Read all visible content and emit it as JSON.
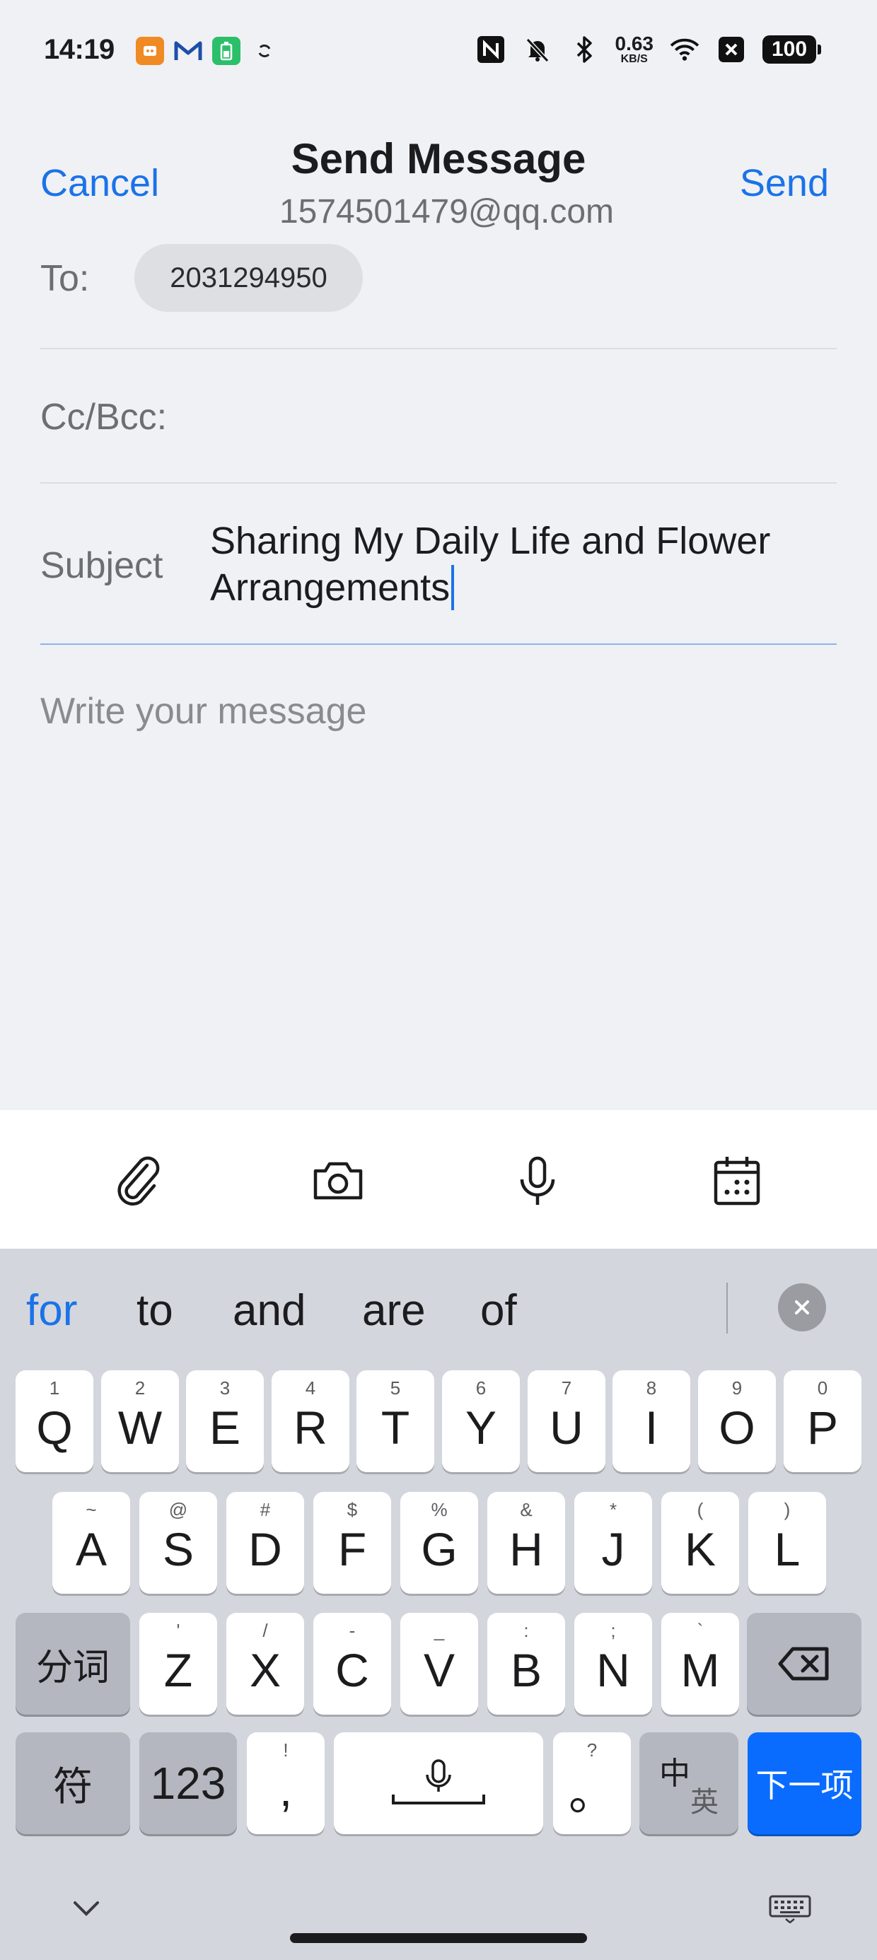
{
  "status_bar": {
    "time": "14:19",
    "net_speed_value": "0.63",
    "net_speed_unit": "KB/S",
    "battery": "100",
    "icons": [
      "app-icon",
      "mail-icon",
      "battery-app-icon",
      "sync-icon",
      "nfc-icon",
      "mute-icon",
      "bluetooth-icon",
      "wifi-icon",
      "x-app-icon"
    ]
  },
  "header": {
    "cancel_label": "Cancel",
    "title": "Send Message",
    "subtitle": "1574501479@qq.com",
    "send_label": "Send"
  },
  "form": {
    "to_label": "To:",
    "to_recipient": "2031294950",
    "cc_label": "Cc/Bcc:",
    "subject_label": "Subject",
    "subject_value": "Sharing My Daily Life and Flower Arrangements",
    "body_placeholder": "Write your message"
  },
  "toolbar": {
    "icons": [
      "paperclip-icon",
      "camera-icon",
      "microphone-icon",
      "calendar-icon"
    ]
  },
  "keyboard": {
    "suggestions": [
      "for",
      "to",
      "and",
      "are",
      "of"
    ],
    "row1": [
      {
        "main": "Q",
        "hint": "1"
      },
      {
        "main": "W",
        "hint": "2"
      },
      {
        "main": "E",
        "hint": "3"
      },
      {
        "main": "R",
        "hint": "4"
      },
      {
        "main": "T",
        "hint": "5"
      },
      {
        "main": "Y",
        "hint": "6"
      },
      {
        "main": "U",
        "hint": "7"
      },
      {
        "main": "I",
        "hint": "8"
      },
      {
        "main": "O",
        "hint": "9"
      },
      {
        "main": "P",
        "hint": "0"
      }
    ],
    "row2": [
      {
        "main": "A",
        "hint": "~"
      },
      {
        "main": "S",
        "hint": "@"
      },
      {
        "main": "D",
        "hint": "#"
      },
      {
        "main": "F",
        "hint": "$"
      },
      {
        "main": "G",
        "hint": "%"
      },
      {
        "main": "H",
        "hint": "&"
      },
      {
        "main": "J",
        "hint": "*"
      },
      {
        "main": "K",
        "hint": "("
      },
      {
        "main": "L",
        "hint": ")"
      }
    ],
    "row3": [
      {
        "main": "Z",
        "hint": "'"
      },
      {
        "main": "X",
        "hint": "/"
      },
      {
        "main": "C",
        "hint": "-"
      },
      {
        "main": "V",
        "hint": "_"
      },
      {
        "main": "B",
        "hint": ":"
      },
      {
        "main": "N",
        "hint": ";"
      },
      {
        "main": "M",
        "hint": "`"
      }
    ],
    "segment_label": "分词",
    "symbols_label": "符",
    "numbers_label": "123",
    "comma": {
      "main": ",",
      "hint": "!"
    },
    "period": {
      "main": "。",
      "hint": "?"
    },
    "lang_main": "中",
    "lang_sub": "英",
    "next_label": "下一项"
  }
}
